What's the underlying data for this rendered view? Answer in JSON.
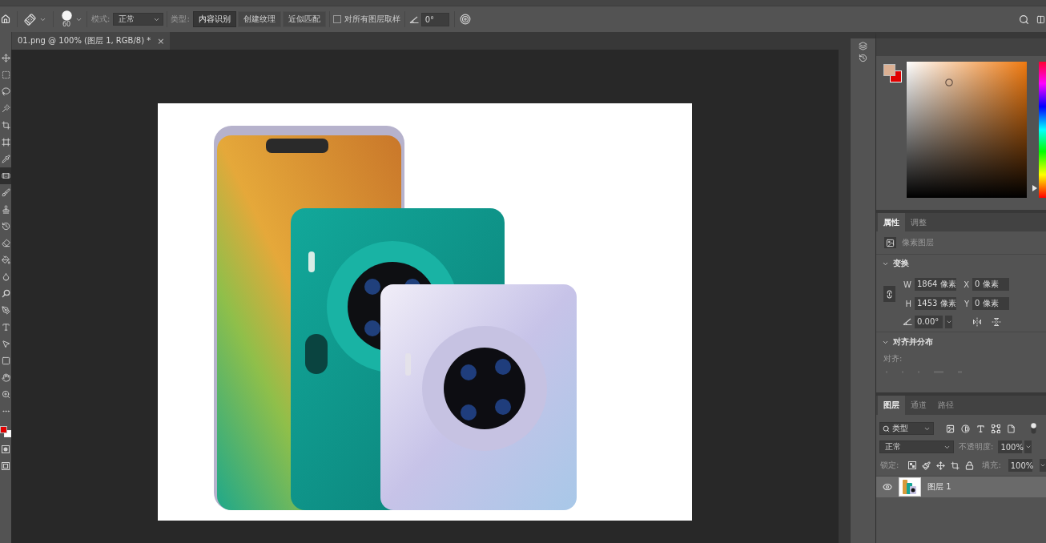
{
  "options_bar": {
    "brush_size": "60",
    "mode": {
      "label": "模式:",
      "value": "正常"
    },
    "type": {
      "label": "类型:",
      "options": [
        {
          "label": "内容识别",
          "selected": true
        },
        {
          "label": "创建纹理",
          "selected": false
        },
        {
          "label": "近似匹配",
          "selected": false
        }
      ]
    },
    "sample_all_layers": {
      "label": "对所有图层取样",
      "checked": false
    },
    "angle": "0°"
  },
  "tools": [
    {
      "kind": "move",
      "selected": false
    },
    {
      "kind": "marquee",
      "selected": false
    },
    {
      "kind": "lasso",
      "selected": false
    },
    {
      "kind": "wand",
      "selected": false
    },
    {
      "kind": "crop",
      "selected": false
    },
    {
      "kind": "frame",
      "selected": false
    },
    {
      "kind": "eyedropper",
      "selected": false
    },
    {
      "kind": "healing",
      "selected": true
    },
    {
      "kind": "brush",
      "selected": false
    },
    {
      "kind": "stamp",
      "selected": false
    },
    {
      "kind": "history",
      "selected": false
    },
    {
      "kind": "eraser",
      "selected": false
    },
    {
      "kind": "bucket",
      "selected": false
    },
    {
      "kind": "blur",
      "selected": false
    },
    {
      "kind": "dodge",
      "selected": false
    },
    {
      "kind": "pen",
      "selected": false
    },
    {
      "kind": "type",
      "selected": false
    },
    {
      "kind": "path_select",
      "selected": false
    },
    {
      "kind": "shape",
      "selected": false
    },
    {
      "kind": "hand",
      "selected": false
    },
    {
      "kind": "zoom",
      "selected": false
    },
    {
      "kind": "more",
      "selected": false
    }
  ],
  "document_tab": {
    "title": "01.png @ 100% (图层 1, RGB/8) *",
    "close": "×"
  },
  "color_panel": {
    "hue_slider": {
      "level": 0.07
    }
  },
  "properties_panel": {
    "tabs": [
      {
        "label": "属性",
        "selected": true
      },
      {
        "label": "调整",
        "selected": false
      }
    ],
    "layer_kind": "像素图层",
    "transform": {
      "title": "变换",
      "expanded": true,
      "fields": [
        {
          "label": "W",
          "value": "1864 像素"
        },
        {
          "label": "X",
          "value": "0 像素"
        },
        {
          "label": "H",
          "value": "1453 像素"
        },
        {
          "label": "Y",
          "value": "0 像素"
        }
      ],
      "angle": "0.00°"
    },
    "align": {
      "title": "对齐并分布",
      "expanded": true,
      "label": "对齐:"
    }
  },
  "layers_panel": {
    "tabs": [
      {
        "label": "图层",
        "selected": true
      },
      {
        "label": "通道",
        "selected": false
      },
      {
        "label": "路径",
        "selected": false
      }
    ],
    "filter": "类型",
    "blend_mode": "正常",
    "opacity": {
      "label": "不透明度:",
      "value": "100%"
    },
    "lock_label": "锁定:",
    "fill": {
      "label": "填充:",
      "value": "100%"
    },
    "layers": [
      {
        "name": "图层 1",
        "visible": true,
        "selected": true
      }
    ]
  }
}
